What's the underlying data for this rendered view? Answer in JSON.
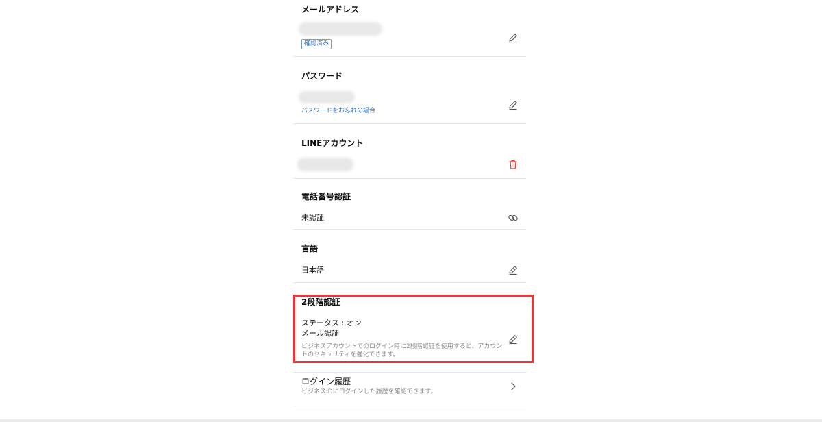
{
  "email": {
    "title": "メールアドレス",
    "badge": "確認済み",
    "action_icon": "pencil-icon"
  },
  "password": {
    "title": "パスワード",
    "forgot_link": "パスワードをお忘れの場合",
    "action_icon": "pencil-icon"
  },
  "line_account": {
    "title": "LINEアカウント",
    "action_icon": "trash-icon"
  },
  "phone_verification": {
    "title": "電話番号認証",
    "value": "未認証",
    "action_icon": "link-icon"
  },
  "language": {
    "title": "言語",
    "value": "日本語",
    "action_icon": "pencil-icon"
  },
  "two_factor": {
    "title": "2段階認証",
    "status": "ステータス : オン",
    "method": "メール認証",
    "description": "ビジネスアカウントでのログイン時に2段階認証を使用すると、アカウントのセキュリティを強化できます。",
    "action_icon": "pencil-icon"
  },
  "login_history": {
    "title": "ログイン履歴",
    "description": "ビジネスIDにログインした履歴を確認できます。",
    "action_icon": "chevron-right-icon"
  },
  "colors": {
    "link": "#2b6fc2",
    "delete_icon": "#d9453b",
    "highlight": "#e03a3a"
  }
}
